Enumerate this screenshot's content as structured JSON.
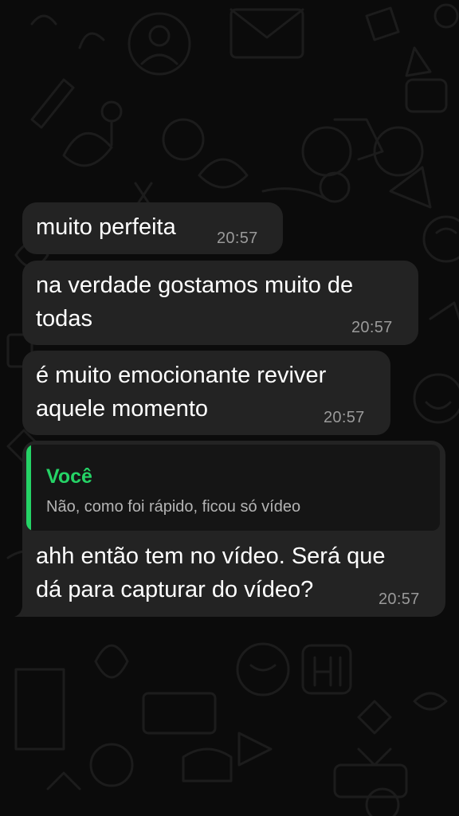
{
  "colors": {
    "background": "#0b0b0b",
    "incoming_bubble": "#232323",
    "quote_background": "#151515",
    "quote_accent": "#25d366",
    "timestamp": "#9a9a9a"
  },
  "messages": [
    {
      "text": "muito perfeita",
      "time": "20:57"
    },
    {
      "text": "na verdade gostamos muito de\ntodas",
      "time": "20:57"
    },
    {
      "text": "é muito emocionante reviver\naquele momento",
      "time": "20:57"
    },
    {
      "quote": {
        "author": "Você",
        "text": "Não, como foi rápido, ficou só vídeo"
      },
      "text": "ahh então tem no vídeo. Será que\ndá para capturar do vídeo?",
      "time": "20:57"
    }
  ]
}
